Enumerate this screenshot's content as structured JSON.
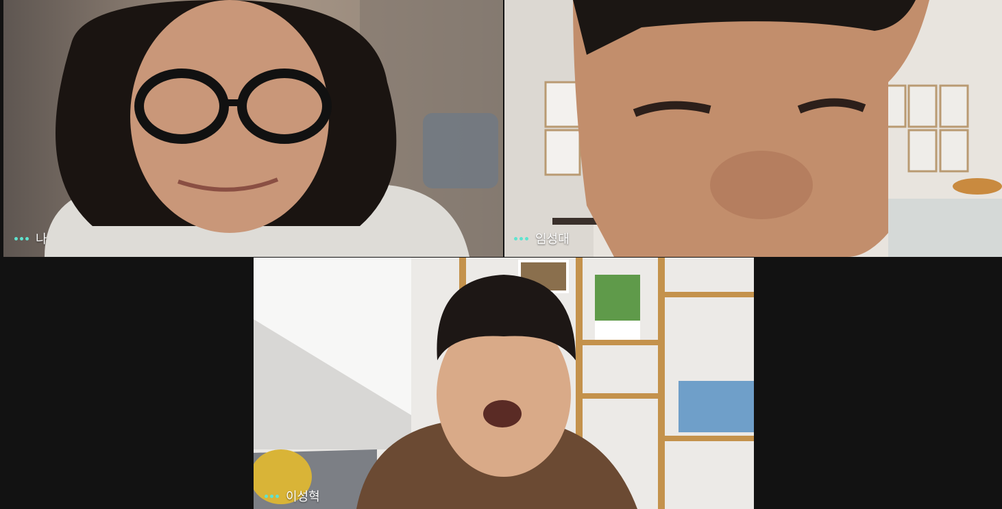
{
  "participants": [
    {
      "name": "나",
      "indicator": "speaking-dots-icon",
      "indicator_color": "#5fe3cf"
    },
    {
      "name": "임성대",
      "indicator": "speaking-dots-icon",
      "indicator_color": "#5fe3cf"
    },
    {
      "name": "이성혁",
      "indicator": "speaking-dots-icon",
      "indicator_color": "#5fe3cf"
    }
  ],
  "background_color": "#121212"
}
